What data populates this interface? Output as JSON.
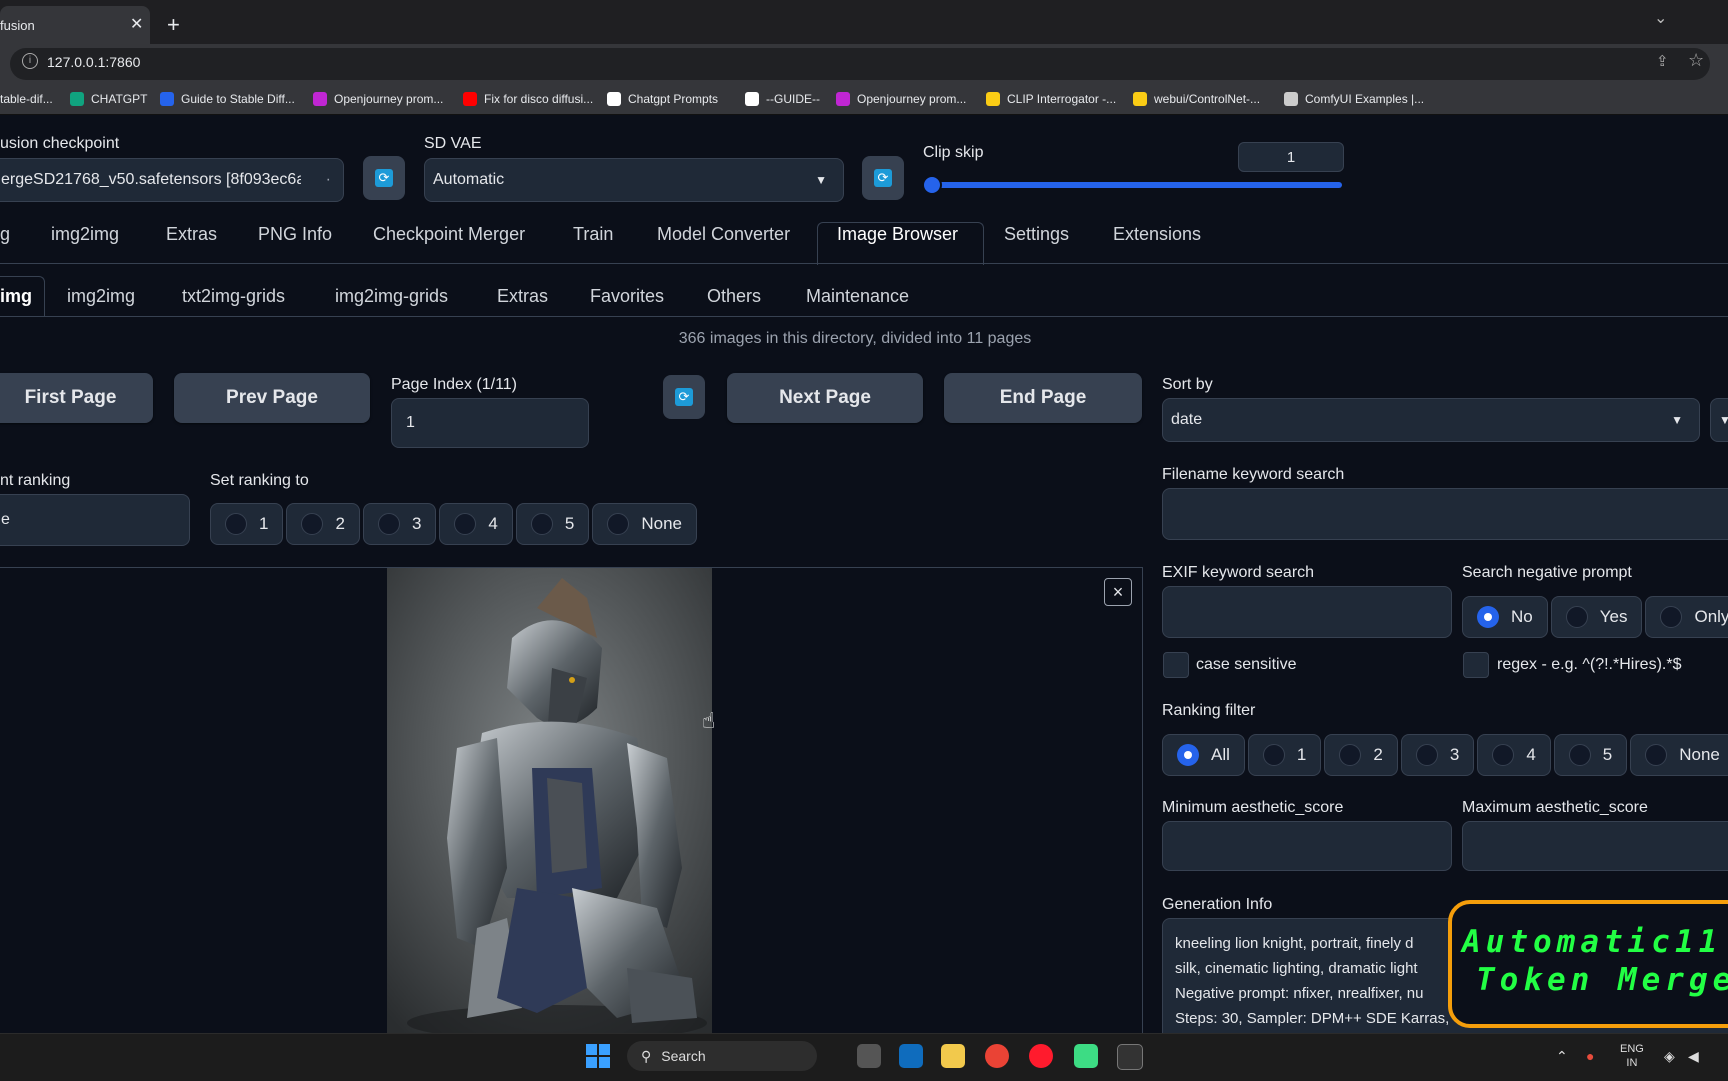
{
  "browser": {
    "tab_title": "fusion",
    "tab_close": "✕",
    "new_tab": "+",
    "url": "127.0.0.1:7860",
    "bookmarks": [
      {
        "label": "table-dif...",
        "color": "#555"
      },
      {
        "label": "CHATGPT",
        "color": "#10a37f"
      },
      {
        "label": "Guide to Stable Diff...",
        "color": "#2563eb"
      },
      {
        "label": "Openjourney prom...",
        "color": "#c026d3"
      },
      {
        "label": "Fix for disco diffusi...",
        "color": "#ff0000"
      },
      {
        "label": "Chatgpt Prompts",
        "color": "#ffffff"
      },
      {
        "label": "--GUIDE--",
        "color": "#ffffff"
      },
      {
        "label": "Openjourney prom...",
        "color": "#c026d3"
      },
      {
        "label": "CLIP Interrogator -...",
        "color": "#facc15"
      },
      {
        "label": "webui/ControlNet-...",
        "color": "#facc15"
      },
      {
        "label": "ComfyUI Examples |...",
        "color": "#cccccc"
      }
    ]
  },
  "settings": {
    "checkpoint_label": "usion checkpoint",
    "checkpoint_value": "ergeSD21768_v50.safetensors [8f093ec6a",
    "vae_label": "SD VAE",
    "vae_value": "Automatic",
    "clip_skip_label": "Clip skip",
    "clip_skip_value": "1"
  },
  "main_tabs": [
    "g",
    "img2img",
    "Extras",
    "PNG Info",
    "Checkpoint Merger",
    "Train",
    "Model Converter",
    "Image Browser",
    "Settings",
    "Extensions"
  ],
  "active_main_tab": "Image Browser",
  "sub_tabs": [
    "img",
    "img2img",
    "txt2img-grids",
    "img2img-grids",
    "Extras",
    "Favorites",
    "Others",
    "Maintenance"
  ],
  "active_sub_tab": "img",
  "status_text": "366 images in this directory, divided into 11 pages",
  "pager": {
    "first": "First Page",
    "prev": "Prev Page",
    "page_index_label": "Page Index (1/11)",
    "page_index_value": "1",
    "next": "Next Page",
    "end": "End Page"
  },
  "ranking": {
    "current_label": "nt ranking",
    "current_value": "e",
    "set_label": "Set ranking to",
    "options": [
      "1",
      "2",
      "3",
      "4",
      "5",
      "None"
    ]
  },
  "filters": {
    "sort_label": "Sort by",
    "sort_value": "date",
    "filename_label": "Filename keyword search",
    "exif_label": "EXIF keyword search",
    "neg_label": "Search negative prompt",
    "neg_options": [
      "No",
      "Yes",
      "Only"
    ],
    "neg_selected": "No",
    "case_sensitive": "case sensitive",
    "regex": "regex - e.g. ^(?!.*Hires).*$",
    "ranking_filter_label": "Ranking filter",
    "ranking_filter_options": [
      "All",
      "1",
      "2",
      "3",
      "4",
      "5",
      "None"
    ],
    "ranking_filter_selected": "All",
    "min_aesthetic_label": "Minimum aesthetic_score",
    "max_aesthetic_label": "Maximum aesthetic_score",
    "gen_info_label": "Generation Info",
    "gen_info_lines": [
      "kneeling lion knight, portrait, finely d",
      "silk, cinematic lighting, dramatic light",
      "Negative prompt: nfixer, nrealfixer, nu",
      "Steps: 30, Sampler: DPM++ SDE Karras,"
    ]
  },
  "gallery": {
    "close": "×"
  },
  "overlay": {
    "line1": "Automatic11",
    "line2": "Token Merge"
  },
  "taskbar": {
    "search_label": "Search",
    "lang_top": "ENG",
    "lang_bottom": "IN"
  }
}
